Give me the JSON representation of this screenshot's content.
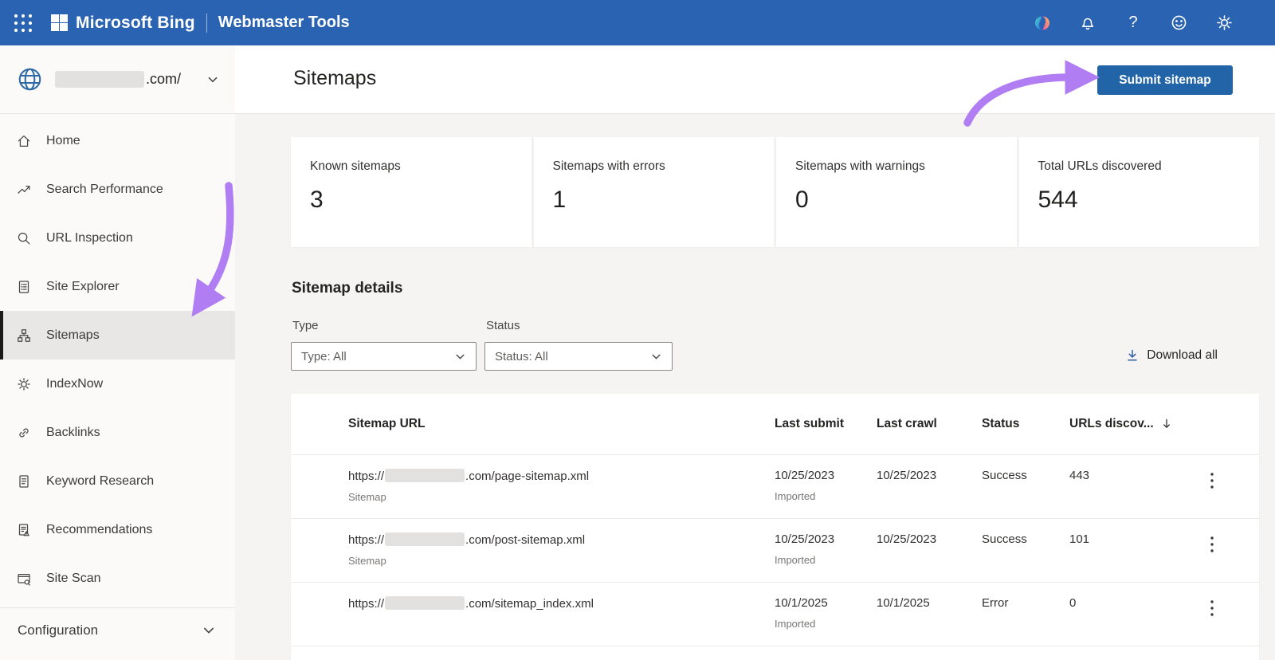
{
  "topbar": {
    "brand": "Microsoft Bing",
    "product": "Webmaster Tools",
    "icons": [
      "apps",
      "copilot",
      "notifications",
      "help",
      "feedback",
      "settings"
    ]
  },
  "sidebar": {
    "site": {
      "domain": ".com/",
      "icon": "globe"
    },
    "items": [
      {
        "label": "Home",
        "icon": "home"
      },
      {
        "label": "Search Performance",
        "icon": "trending-up"
      },
      {
        "label": "URL Inspection",
        "icon": "search"
      },
      {
        "label": "Site Explorer",
        "icon": "site-explorer"
      },
      {
        "label": "Sitemaps",
        "icon": "sitemap",
        "selected": true
      },
      {
        "label": "IndexNow",
        "icon": "indexnow"
      },
      {
        "label": "Backlinks",
        "icon": "backlinks"
      },
      {
        "label": "Keyword Research",
        "icon": "keyword-research"
      },
      {
        "label": "Recommendations",
        "icon": "recommendations"
      },
      {
        "label": "Site Scan",
        "icon": "site-scan"
      }
    ],
    "configuration": {
      "label": "Configuration"
    }
  },
  "header": {
    "title": "Sitemaps",
    "submit_button": "Submit sitemap"
  },
  "stats": [
    {
      "label": "Known sitemaps",
      "value": "3"
    },
    {
      "label": "Sitemaps with errors",
      "value": "1"
    },
    {
      "label": "Sitemaps with warnings",
      "value": "0"
    },
    {
      "label": "Total URLs discovered",
      "value": "544"
    }
  ],
  "details": {
    "heading": "Sitemap details",
    "type_label": "Type",
    "type_value": "Type: All",
    "status_label": "Status",
    "status_value": "Status: All",
    "download_all": "Download all"
  },
  "table": {
    "columns": [
      "Sitemap URL",
      "Last submit",
      "Last crawl",
      "Status",
      "URLs discov..."
    ],
    "rows": [
      {
        "url_prefix": "https://",
        "url_suffix": ".com/page-sitemap.xml",
        "type": "Sitemap",
        "last_submit": "10/25/2023",
        "submit_note": "Imported",
        "last_crawl": "10/25/2023",
        "status": "Success",
        "urls_discovered": "443"
      },
      {
        "url_prefix": "https://",
        "url_suffix": ".com/post-sitemap.xml",
        "type": "Sitemap",
        "last_submit": "10/25/2023",
        "submit_note": "Imported",
        "last_crawl": "10/25/2023",
        "status": "Success",
        "urls_discovered": "101"
      },
      {
        "url_prefix": "https://",
        "url_suffix": ".com/sitemap_index.xml",
        "type": "",
        "last_submit": "10/1/2025",
        "submit_note": "Imported",
        "last_crawl": "10/1/2025",
        "status": "Error",
        "urls_discovered": "0"
      }
    ]
  },
  "colors": {
    "topbar_blue": "#2a63b2",
    "button_blue": "#2264a8",
    "success_green": "#427a42",
    "error_red": "#a4373a",
    "annotation_purple": "#b17df2",
    "selected_item_bg": "#e8e7e5"
  }
}
